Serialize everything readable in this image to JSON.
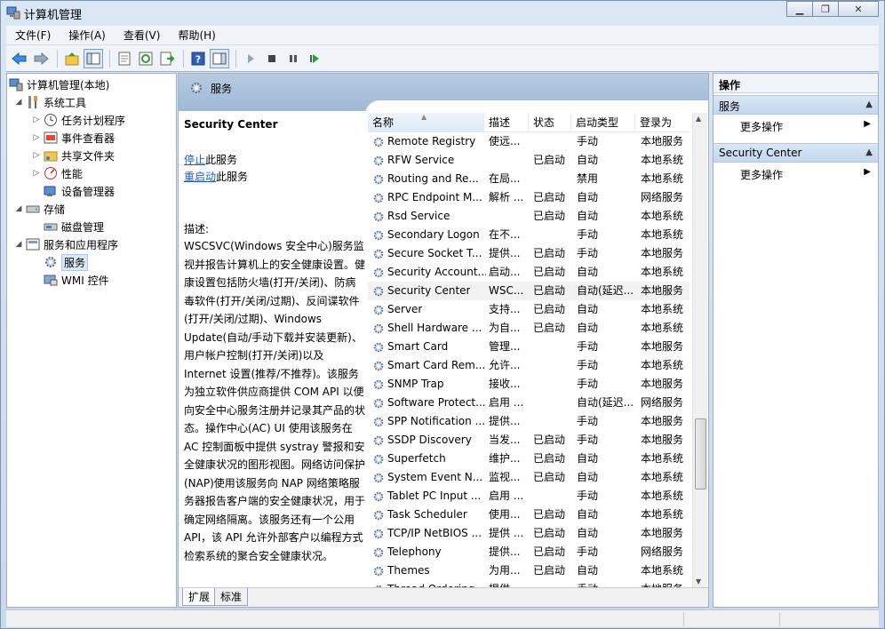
{
  "window": {
    "title": "计算机管理"
  },
  "menu": [
    "文件(F)",
    "操作(A)",
    "查看(V)",
    "帮助(H)"
  ],
  "toolbar": [
    "back-icon",
    "forward-icon",
    "up-folder-icon",
    "show-hide-tree-icon",
    "properties-icon",
    "refresh-icon",
    "export-list-icon",
    "help-icon",
    "show-hide-action-pane-icon",
    "start-service-icon",
    "stop-service-icon",
    "pause-service-icon",
    "restart-service-icon"
  ],
  "tree": {
    "root": "计算机管理(本地)",
    "system_tools": "系统工具",
    "task_scheduler": "任务计划程序",
    "event_viewer": "事件查看器",
    "shared_folders": "共享文件夹",
    "performance": "性能",
    "device_manager": "设备管理器",
    "storage": "存储",
    "disk_management": "磁盘管理",
    "services_apps": "服务和应用程序",
    "services": "服务",
    "wmi": "WMI 控件"
  },
  "center": {
    "header": "服务",
    "selected_service": "Security Center",
    "stop_link": "停止",
    "stop_suffix": "此服务",
    "restart_link": "重启动",
    "restart_suffix": "此服务",
    "desc_label": "描述:",
    "description": "WSCSVC(Windows 安全中心)服务监视并报告计算机上的安全健康设置。健康设置包括防火墙(打开/关闭)、防病毒软件(打开/关闭/过期)、反间谍软件(打开/关闭/过期)、Windows Update(自动/手动下载并安装更新)、用户帐户控制(打开/关闭)以及 Internet 设置(推荐/不推荐)。该服务为独立软件供应商提供 COM API 以便向安全中心服务注册并记录其产品的状态。操作中心(AC) UI 使用该服务在 AC 控制面板中提供 systray 警报和安全健康状况的图形视图。网络访问保护(NAP)使用该服务向 NAP 网络策略服务器报告客户端的安全健康状况，用于确定网络隔离。该服务还有一个公用 API，该 API 允许外部客户以编程方式检索系统的聚合安全健康状况。",
    "columns": {
      "name": "名称",
      "desc": "描述",
      "status": "状态",
      "start": "启动类型",
      "logon": "登录为"
    },
    "services": [
      {
        "name": "Remote Registry",
        "desc": "使远...",
        "status": "",
        "start": "手动",
        "logon": "本地服务"
      },
      {
        "name": "RFW Service",
        "desc": "",
        "status": "已启动",
        "start": "自动",
        "logon": "本地系统"
      },
      {
        "name": "Routing and Re...",
        "desc": "在局...",
        "status": "",
        "start": "禁用",
        "logon": "本地系统"
      },
      {
        "name": "RPC Endpoint M...",
        "desc": "解析 ...",
        "status": "已启动",
        "start": "自动",
        "logon": "网络服务"
      },
      {
        "name": "Rsd Service",
        "desc": "",
        "status": "已启动",
        "start": "自动",
        "logon": "本地系统"
      },
      {
        "name": "Secondary Logon",
        "desc": "在不...",
        "status": "",
        "start": "手动",
        "logon": "本地系统"
      },
      {
        "name": "Secure Socket T...",
        "desc": "提供...",
        "status": "已启动",
        "start": "手动",
        "logon": "本地服务"
      },
      {
        "name": "Security Account...",
        "desc": "启动...",
        "status": "已启动",
        "start": "自动",
        "logon": "本地系统"
      },
      {
        "name": "Security Center",
        "desc": "WSC...",
        "status": "已启动",
        "start": "自动(延迟...",
        "logon": "本地服务"
      },
      {
        "name": "Server",
        "desc": "支持...",
        "status": "已启动",
        "start": "自动",
        "logon": "本地系统"
      },
      {
        "name": "Shell Hardware ...",
        "desc": "为自...",
        "status": "已启动",
        "start": "自动",
        "logon": "本地系统"
      },
      {
        "name": "Smart Card",
        "desc": "管理...",
        "status": "",
        "start": "手动",
        "logon": "本地服务"
      },
      {
        "name": "Smart Card Rem...",
        "desc": "允许...",
        "status": "",
        "start": "手动",
        "logon": "本地系统"
      },
      {
        "name": "SNMP Trap",
        "desc": "接收...",
        "status": "",
        "start": "手动",
        "logon": "本地服务"
      },
      {
        "name": "Software Protect...",
        "desc": "启用 ...",
        "status": "",
        "start": "自动(延迟...",
        "logon": "网络服务"
      },
      {
        "name": "SPP Notification ...",
        "desc": "提供...",
        "status": "",
        "start": "手动",
        "logon": "本地服务"
      },
      {
        "name": "SSDP Discovery",
        "desc": "当发...",
        "status": "已启动",
        "start": "手动",
        "logon": "本地服务"
      },
      {
        "name": "Superfetch",
        "desc": "维护...",
        "status": "已启动",
        "start": "自动",
        "logon": "本地系统"
      },
      {
        "name": "System Event N...",
        "desc": "监视...",
        "status": "已启动",
        "start": "自动",
        "logon": "本地系统"
      },
      {
        "name": "Tablet PC Input ...",
        "desc": "启用 ...",
        "status": "",
        "start": "手动",
        "logon": "本地系统"
      },
      {
        "name": "Task Scheduler",
        "desc": "使用...",
        "status": "已启动",
        "start": "自动",
        "logon": "本地系统"
      },
      {
        "name": "TCP/IP NetBIOS ...",
        "desc": "提供 ...",
        "status": "已启动",
        "start": "自动",
        "logon": "本地服务"
      },
      {
        "name": "Telephony",
        "desc": "提供...",
        "status": "已启动",
        "start": "手动",
        "logon": "网络服务"
      },
      {
        "name": "Themes",
        "desc": "为用...",
        "status": "已启动",
        "start": "自动",
        "logon": "本地系统"
      },
      {
        "name": "Thread Ordering...",
        "desc": "提供...",
        "status": "",
        "start": "手动",
        "logon": "本地服务"
      }
    ],
    "selected_index": 8,
    "tabs": [
      "扩展",
      "标准"
    ]
  },
  "actions": {
    "title": "操作",
    "sections": [
      {
        "label": "服务",
        "item": "更多操作"
      },
      {
        "label": "Security Center",
        "item": "更多操作"
      }
    ]
  }
}
